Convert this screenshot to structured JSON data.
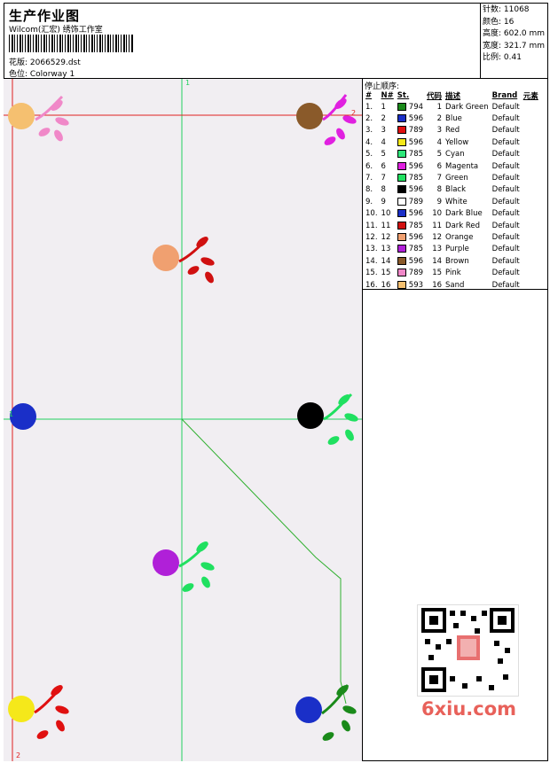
{
  "header": {
    "title": "生产作业图",
    "company": "Wilcom(汇宏) 绣饰工作室",
    "design_file": "花版: 2066529.dst",
    "colorway": "色位: Colorway 1"
  },
  "stats": {
    "stitches": "针数: 11068",
    "colors": "颜色: 16",
    "height": "高度: 602.0 mm",
    "width": "宽度: 321.7 mm",
    "scale": "比例: 0.41"
  },
  "stop_sequence": {
    "title": "停止顺序:",
    "headers": [
      "#",
      "N#",
      "St.",
      "代码",
      "描述",
      "Brand",
      "元素"
    ],
    "rows": [
      {
        "idx": "1.",
        "n": "1",
        "color": "#1a8a1a",
        "st": "794",
        "code": "1",
        "desc": "Dark Green",
        "brand": "Default"
      },
      {
        "idx": "2.",
        "n": "2",
        "color": "#1a2fc8",
        "st": "596",
        "code": "2",
        "desc": "Blue",
        "brand": "Default"
      },
      {
        "idx": "3.",
        "n": "3",
        "color": "#e01010",
        "st": "789",
        "code": "3",
        "desc": "Red",
        "brand": "Default"
      },
      {
        "idx": "4.",
        "n": "4",
        "color": "#f5e81a",
        "st": "596",
        "code": "4",
        "desc": "Yellow",
        "brand": "Default"
      },
      {
        "idx": "5.",
        "n": "5",
        "color": "#2ee87a",
        "st": "785",
        "code": "5",
        "desc": "Cyan",
        "brand": "Default"
      },
      {
        "idx": "6.",
        "n": "6",
        "color": "#e020e0",
        "st": "596",
        "code": "6",
        "desc": "Magenta",
        "brand": "Default"
      },
      {
        "idx": "7.",
        "n": "7",
        "color": "#20e060",
        "st": "785",
        "code": "7",
        "desc": "Green",
        "brand": "Default"
      },
      {
        "idx": "8.",
        "n": "8",
        "color": "#000000",
        "st": "596",
        "code": "8",
        "desc": "Black",
        "brand": "Default"
      },
      {
        "idx": "9.",
        "n": "9",
        "color": "#ffffff",
        "st": "789",
        "code": "9",
        "desc": "White",
        "brand": "Default"
      },
      {
        "idx": "10.",
        "n": "10",
        "color": "#1a2fc8",
        "st": "596",
        "code": "10",
        "desc": "Dark Blue",
        "brand": "Default"
      },
      {
        "idx": "11.",
        "n": "11",
        "color": "#d01010",
        "st": "785",
        "code": "11",
        "desc": "Dark Red",
        "brand": "Default"
      },
      {
        "idx": "12.",
        "n": "12",
        "color": "#f0a070",
        "st": "596",
        "code": "12",
        "desc": "Orange",
        "brand": "Default"
      },
      {
        "idx": "13.",
        "n": "13",
        "color": "#b020d8",
        "st": "785",
        "code": "13",
        "desc": "Purple",
        "brand": "Default"
      },
      {
        "idx": "14.",
        "n": "14",
        "color": "#8a5a2a",
        "st": "596",
        "code": "14",
        "desc": "Brown",
        "brand": "Default"
      },
      {
        "idx": "15.",
        "n": "15",
        "color": "#f088c8",
        "st": "789",
        "code": "15",
        "desc": "Pink",
        "brand": "Default"
      },
      {
        "idx": "16.",
        "n": "16",
        "color": "#f5c070",
        "st": "593",
        "code": "16",
        "desc": "Sand",
        "brand": "Default"
      }
    ]
  },
  "design_labels": {
    "top_marker": "1",
    "right_marker": "2",
    "bottom_marker": "2",
    "left_marker": "1"
  },
  "watermark": "6xiu.com",
  "colors": {
    "guide_green": "#22d060",
    "guide_red": "#e02020",
    "path_green": "#30b030"
  }
}
